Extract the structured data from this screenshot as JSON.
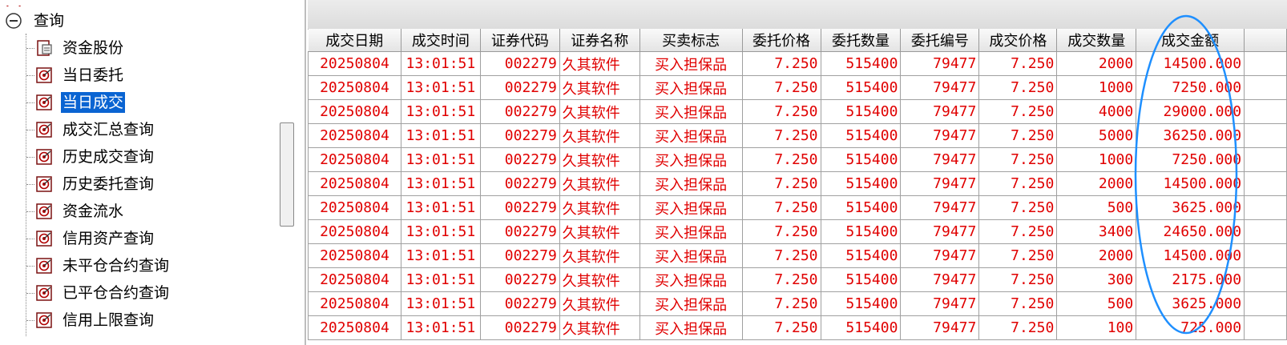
{
  "tree": {
    "top_clipped": "",
    "root": {
      "label": "查询",
      "icon": "minus-circle-icon"
    },
    "items": [
      {
        "label": "资金股份",
        "icon": "document-icon",
        "selected": false
      },
      {
        "label": "当日委托",
        "icon": "target-icon",
        "selected": false
      },
      {
        "label": "当日成交",
        "icon": "target-icon",
        "selected": true
      },
      {
        "label": "成交汇总查询",
        "icon": "target-icon",
        "selected": false
      },
      {
        "label": "历史成交查询",
        "icon": "target-icon",
        "selected": false
      },
      {
        "label": "历史委托查询",
        "icon": "target-icon",
        "selected": false
      },
      {
        "label": "资金流水",
        "icon": "target-icon",
        "selected": false
      },
      {
        "label": "信用资产查询",
        "icon": "target-icon",
        "selected": false
      },
      {
        "label": "未平仓合约查询",
        "icon": "target-icon",
        "selected": false
      },
      {
        "label": "已平仓合约查询",
        "icon": "target-icon",
        "selected": false
      },
      {
        "label": "信用上限查询",
        "icon": "target-icon",
        "selected": false
      }
    ]
  },
  "colors": {
    "data_text": "#e00000",
    "selection": "#0a64d2",
    "annotation": "#1e8fff"
  },
  "table": {
    "columns": [
      "成交日期",
      "成交时间",
      "证券代码",
      "证券名称",
      "买卖标志",
      "委托价格",
      "委托数量",
      "委托编号",
      "成交价格",
      "成交数量",
      "成交金额"
    ],
    "rows": [
      [
        "20250804",
        "13:01:51",
        "002279",
        "久其软件",
        "买入担保品",
        "7.250",
        "515400",
        "79477",
        "7.250",
        "2000",
        "14500.000"
      ],
      [
        "20250804",
        "13:01:51",
        "002279",
        "久其软件",
        "买入担保品",
        "7.250",
        "515400",
        "79477",
        "7.250",
        "1000",
        "7250.000"
      ],
      [
        "20250804",
        "13:01:51",
        "002279",
        "久其软件",
        "买入担保品",
        "7.250",
        "515400",
        "79477",
        "7.250",
        "4000",
        "29000.000"
      ],
      [
        "20250804",
        "13:01:51",
        "002279",
        "久其软件",
        "买入担保品",
        "7.250",
        "515400",
        "79477",
        "7.250",
        "5000",
        "36250.000"
      ],
      [
        "20250804",
        "13:01:51",
        "002279",
        "久其软件",
        "买入担保品",
        "7.250",
        "515400",
        "79477",
        "7.250",
        "1000",
        "7250.000"
      ],
      [
        "20250804",
        "13:01:51",
        "002279",
        "久其软件",
        "买入担保品",
        "7.250",
        "515400",
        "79477",
        "7.250",
        "2000",
        "14500.000"
      ],
      [
        "20250804",
        "13:01:51",
        "002279",
        "久其软件",
        "买入担保品",
        "7.250",
        "515400",
        "79477",
        "7.250",
        "500",
        "3625.000"
      ],
      [
        "20250804",
        "13:01:51",
        "002279",
        "久其软件",
        "买入担保品",
        "7.250",
        "515400",
        "79477",
        "7.250",
        "3400",
        "24650.000"
      ],
      [
        "20250804",
        "13:01:51",
        "002279",
        "久其软件",
        "买入担保品",
        "7.250",
        "515400",
        "79477",
        "7.250",
        "2000",
        "14500.000"
      ],
      [
        "20250804",
        "13:01:51",
        "002279",
        "久其软件",
        "买入担保品",
        "7.250",
        "515400",
        "79477",
        "7.250",
        "300",
        "2175.000"
      ],
      [
        "20250804",
        "13:01:51",
        "002279",
        "久其软件",
        "买入担保品",
        "7.250",
        "515400",
        "79477",
        "7.250",
        "500",
        "3625.000"
      ],
      [
        "20250804",
        "13:01:51",
        "002279",
        "久其软件",
        "买入担保品",
        "7.250",
        "515400",
        "79477",
        "7.250",
        "100",
        "725.000"
      ]
    ]
  }
}
